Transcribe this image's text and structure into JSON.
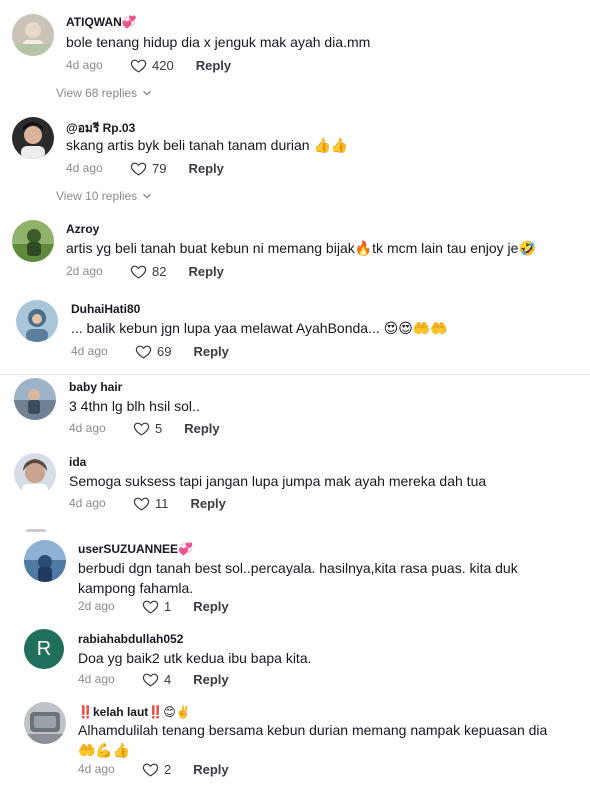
{
  "comments": [
    {
      "username": "ATIQWAN💞",
      "text": "bole tenang hidup dia x jenguk mak ayah dia.mm",
      "date": "4d ago",
      "likes": "420",
      "reply": "Reply",
      "view_replies": "View 68 replies"
    },
    {
      "username": "@อมรี Rp.03",
      "text": "skang artis byk beli tanah tanam durian 👍👍",
      "date": "4d ago",
      "likes": "79",
      "reply": "Reply",
      "view_replies": "View 10 replies"
    },
    {
      "username": "Azroy",
      "text": "artis yg beli tanah buat kebun ni memang bijak🔥tk mcm lain tau enjoy je🤣",
      "date": "2d ago",
      "likes": "82",
      "reply": "Reply"
    },
    {
      "username": "DuhaiHati80",
      "text": "... balik kebun jgn lupa yaa melawat AyahBonda... 😍😍🤲🤲",
      "date": "4d ago",
      "likes": "69",
      "reply": "Reply"
    },
    {
      "username": "baby hair",
      "text": "3 4thn lg blh hsil sol..",
      "date": "4d ago",
      "likes": "5",
      "reply": "Reply"
    },
    {
      "username": "ida",
      "text": "Semoga suksess tapi jangan lupa jumpa mak ayah mereka dah tua",
      "date": "4d ago",
      "likes": "11",
      "reply": "Reply"
    },
    {
      "username": "userSUZUANNEE💞",
      "text": "berbudi dgn tanah best sol..percayala. hasilnya,kita rasa puas. kita duk kampong fahamla.",
      "date": "2d ago",
      "likes": "1",
      "reply": "Reply"
    },
    {
      "username": "rabiahabdullah052",
      "text": "Doa yg baik2 utk kedua ibu bapa kita.",
      "date": "4d ago",
      "likes": "4",
      "reply": "Reply",
      "avatar_letter": "R"
    },
    {
      "username": "‼️kelah laut‼️😊✌️",
      "text": "Alhamdulilah tenang bersama kebun durian memang nampak kepuasan dia 🤲💪👍",
      "date": "4d ago",
      "likes": "2",
      "reply": "Reply"
    }
  ],
  "colors": {
    "text": "#161823",
    "meta": "#8a8b91",
    "divider": "#e3e3e4",
    "avatar_letter_bg": "#1f6f5c"
  },
  "icons": {
    "like": "heart-outline-icon",
    "expand": "chevron-down-icon"
  }
}
